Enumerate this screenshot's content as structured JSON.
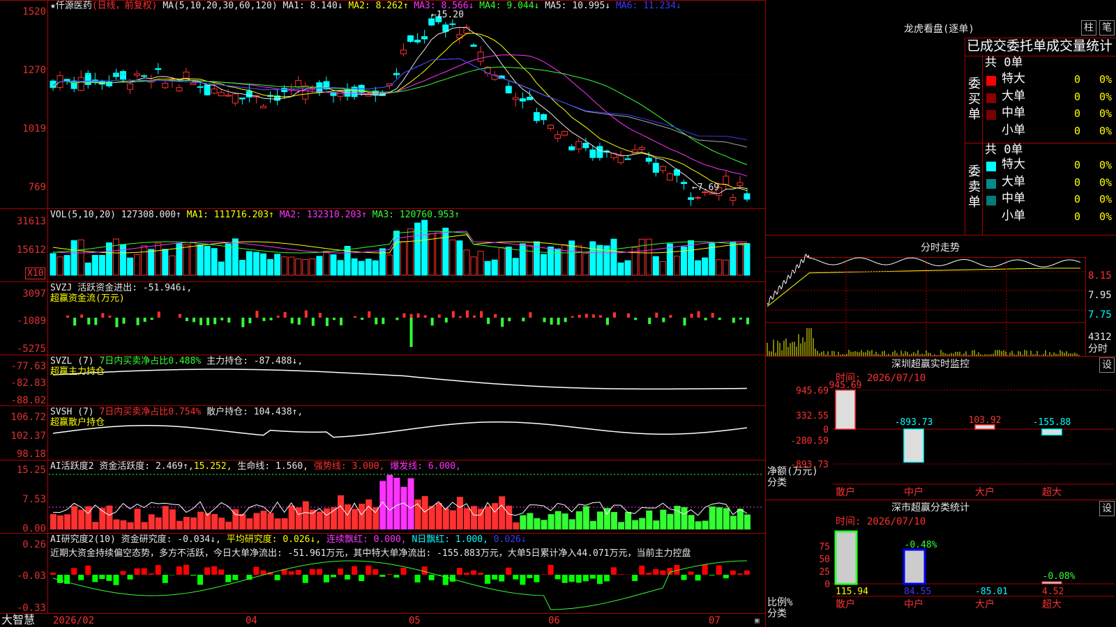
{
  "stock": {
    "name_line": "★仟源医药",
    "period": "(日线，前复权)",
    "ma_label": "MA(5,10,20,30,60,120)",
    "ma1": "MA1: 8.140↓",
    "ma2": "MA2: 8.262↑",
    "ma3": "MA3: 8.566↓",
    "ma4": "MA4: 9.044↓",
    "ma5": "MA5: 10.995↓",
    "ma6": "MA6: 11.234↓",
    "y_labels": [
      "1520",
      "1270",
      "1019",
      "769"
    ],
    "high_label": "←15.20",
    "low_label": "←7.69"
  },
  "vol": {
    "label": "VOL(5,10,20)",
    "value": "127308.000↑",
    "ma1": "MA1: 111716.203↑",
    "ma2": "MA2: 132310.203↑",
    "ma3": "MA3: 120760.953↑",
    "y_labels": [
      "31613",
      "15612"
    ],
    "unit": "X10"
  },
  "svzj": {
    "label": "SVZJ",
    "desc": "活跃资金进出: -51.946↓,",
    "sub": "超赢资金流(万元)",
    "y_labels": [
      "3097",
      "-1089",
      "-5275"
    ]
  },
  "svzl": {
    "label": "SVZL (7)",
    "ratio": "7日内买卖净占比0.488%",
    "hold": "主力持仓: -87.488↓,",
    "sub": "超赢主力持仓",
    "y_labels": [
      "-77.63",
      "-82.83",
      "-88.02"
    ]
  },
  "svsh": {
    "label": "SVSH (7)",
    "ratio": "7日内买卖净占比0.754%",
    "hold": "散户持仓: 104.438↑,",
    "sub": "超赢散户持仓",
    "y_labels": [
      "106.72",
      "102.37",
      "98.18"
    ]
  },
  "ai1": {
    "label": "AI活跃度2 资金活跃度: 2.469↑,",
    "v2": "15.252,",
    "life": "生命线: 1.560,",
    "strong": "强势线: 3.000,",
    "burst": "爆发线: 6.000,",
    "y_labels": [
      "15.25",
      "7.53",
      "0.00"
    ]
  },
  "ai2": {
    "label": "AI研究度2(10) 资金研究度: -0.034↓,",
    "avg": "平均研究度: 0.026↓,",
    "red": "连续飘红: 0.000,",
    "nred": "N日飘红: 1.000,",
    "last": "0.026↓",
    "note": "近期大资金持续偏空态势，多方不活跃，今日大单净流出: -51.961万元，其中特大单净流出: -155.883万元，大单5日累计净入44.071万元，当前主力控盘",
    "y_labels": [
      "0.26",
      "-0.03",
      "-0.33"
    ]
  },
  "xaxis": {
    "app": "大智慧",
    "labels": [
      "2026/02",
      "04",
      "05",
      "06",
      "07"
    ]
  },
  "dragon": {
    "title": "龙虎看盘(逐单)",
    "btn1": "柱",
    "btn2": "笔",
    "header": "已成交委托单成交量统计",
    "buy_label": "委买单",
    "sell_label": "委卖单",
    "buy_total": "共 0单",
    "sell_total": "共 0单",
    "buy_rows": [
      {
        "label": "特大",
        "count": "0",
        "pct": "0%",
        "color": "#ff0000"
      },
      {
        "label": "大单",
        "count": "0",
        "pct": "0%",
        "color": "#8b0000"
      },
      {
        "label": "中单",
        "count": "0",
        "pct": "0%",
        "color": "#7a0000"
      },
      {
        "label": "小单",
        "count": "0",
        "pct": "0%",
        "color": ""
      }
    ],
    "sell_rows": [
      {
        "label": "特大",
        "count": "0",
        "pct": "0%",
        "color": "#00ffff"
      },
      {
        "label": "大单",
        "count": "0",
        "pct": "0%",
        "color": "#008b8b"
      },
      {
        "label": "中单",
        "count": "0",
        "pct": "0%",
        "color": "#007a7a"
      },
      {
        "label": "小单",
        "count": "0",
        "pct": "0%",
        "color": ""
      }
    ]
  },
  "intraday": {
    "title": "分时走势",
    "y_labels": [
      "8.15",
      "7.95",
      "7.75"
    ],
    "vol_label": "4312",
    "vol_unit": "分时"
  },
  "sz_monitor": {
    "title": "深圳超赢实时监控",
    "btn": "设",
    "time": "时间: 2026/07/10",
    "y_labels": [
      "945.69",
      "332.55",
      "0",
      "-280.59",
      "-893.73"
    ],
    "axis_title": "净额(万元)",
    "axis_sub": "分类",
    "bars": [
      {
        "label": "散户",
        "value": "945.69"
      },
      {
        "label": "中户",
        "value": "-893.73"
      },
      {
        "label": "大户",
        "value": "103.92"
      },
      {
        "label": "超大",
        "value": "-155.88"
      }
    ]
  },
  "sz_class": {
    "title": "深市超赢分类统计",
    "btn": "设",
    "time": "时间: 2026/07/10",
    "y_labels": [
      "75",
      "50",
      "25",
      "0"
    ],
    "axis_title": "比例%",
    "axis_sub": "分类",
    "bar_labels": [
      "-0.48%",
      "-0.08%"
    ],
    "values": [
      "115.94",
      "84.55",
      "-85.01",
      "4.52"
    ],
    "cats": [
      "散户",
      "中户",
      "大户",
      "超大"
    ]
  }
}
